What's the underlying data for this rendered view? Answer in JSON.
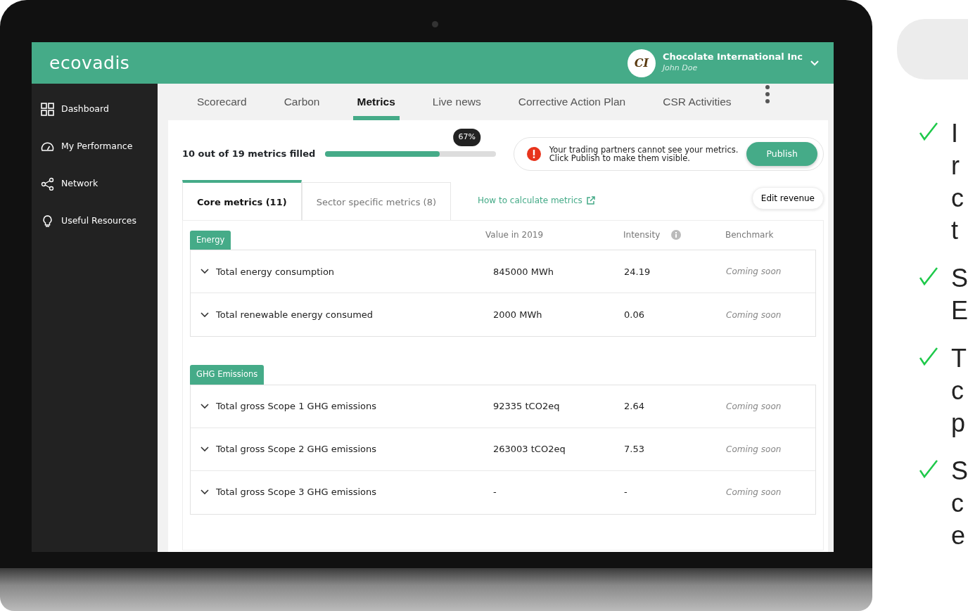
{
  "app": {
    "logo": "ecovadis",
    "account": {
      "initials": "CI",
      "company": "Chocolate International Inc",
      "user": "John Doe"
    }
  },
  "sidebar": {
    "items": [
      {
        "label": "Dashboard"
      },
      {
        "label": "My Performance"
      },
      {
        "label": "Network"
      },
      {
        "label": "Useful Resources"
      }
    ]
  },
  "tabs": [
    {
      "label": "Scorecard",
      "selected": false
    },
    {
      "label": "Carbon",
      "selected": false
    },
    {
      "label": "Metrics",
      "selected": true
    },
    {
      "label": "Live news",
      "selected": false
    },
    {
      "label": "Corrective Action Plan",
      "selected": false
    },
    {
      "label": "CSR Activities",
      "selected": false
    }
  ],
  "progress": {
    "label": "10 out of 19 metrics filled",
    "level": 0.67,
    "reading": "67%"
  },
  "notice": {
    "lines": [
      "Your trading partners cannot see your metrics.",
      "Click Publish to make them visible."
    ],
    "button": "Publish"
  },
  "subtabs": [
    {
      "label": "Core metrics (11)",
      "selected": true
    },
    {
      "label": "Sector specific metrics (8)",
      "selected": false
    }
  ],
  "help_link": "How to calculate metrics",
  "edit_button": "Edit revenue",
  "table": {
    "columns": [
      "Value in 2019",
      "Intensity",
      "Benchmark"
    ],
    "groups": [
      {
        "name": "Energy",
        "rows": [
          {
            "metric": "Total energy consumption",
            "value": "845000 MWh",
            "intensity": "24.19",
            "benchmark": "Coming soon"
          },
          {
            "metric": "Total renewable energy consumed",
            "value": "2000 MWh",
            "intensity": "0.06",
            "benchmark": "Coming soon"
          }
        ]
      },
      {
        "name": "GHG Emissions",
        "rows": [
          {
            "metric": "Total gross Scope 1 GHG emissions",
            "value": "92335 tCO2eq",
            "intensity": "2.64",
            "benchmark": "Coming soon"
          },
          {
            "metric": "Total gross Scope 2 GHG emissions",
            "value": "263003 tCO2eq",
            "intensity": "7.53",
            "benchmark": "Coming soon"
          },
          {
            "metric": "Total gross Scope 3 GHG emissions",
            "value": "-",
            "intensity": "-",
            "benchmark": "Coming soon"
          }
        ]
      }
    ]
  },
  "side_panel": {
    "bullets": [
      {
        "lines": [
          "I",
          "r",
          "c",
          "t"
        ]
      },
      {
        "lines": [
          "S",
          "E"
        ]
      },
      {
        "lines": [
          "T",
          "c",
          "p"
        ]
      },
      {
        "lines": [
          "S",
          "c",
          "e"
        ]
      }
    ]
  }
}
